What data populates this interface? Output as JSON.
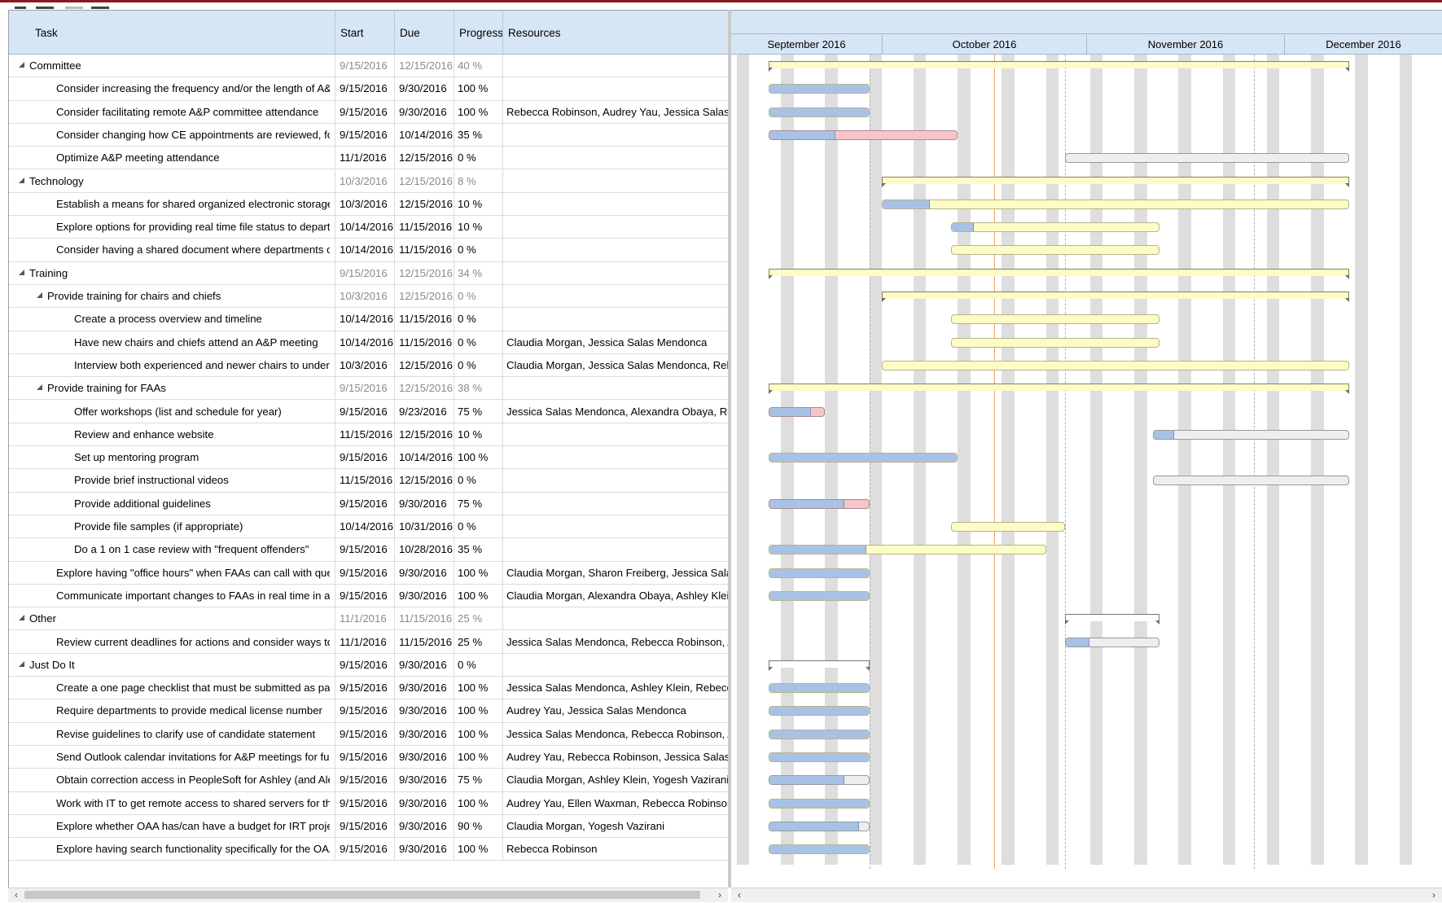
{
  "columns": {
    "task": "Task",
    "start": "Start",
    "due": "Due",
    "progress": "Progress",
    "resources": "Resources"
  },
  "months": [
    "September 2016",
    "October 2016",
    "November 2016",
    "December 2016"
  ],
  "scroll": {
    "left_arrow": "‹",
    "right_arrow": "›"
  },
  "colors": {
    "header_bg": "#d7e6f4",
    "progress_fill": "#a8c2e6",
    "bar_yellow": "#fdfbc6",
    "bar_red": "#f7c5c9",
    "bar_gray": "#eeeeee",
    "today_line": "#f0a060"
  },
  "rows": [
    {
      "task": "Committee",
      "start": "9/15/2016",
      "due": "12/15/2016",
      "progress": "40 %",
      "resources": "",
      "level": 0,
      "summary": true,
      "fill": 0.4,
      "color": "yellow"
    },
    {
      "task": "Consider increasing the frequency and/or the length of A&P meetings ...",
      "start": "9/15/2016",
      "due": "9/30/2016",
      "progress": "100 %",
      "resources": "",
      "level": 1,
      "fill": 1,
      "color": "yellow"
    },
    {
      "task": "Consider facilitating remote A&P committee attendance",
      "start": "9/15/2016",
      "due": "9/30/2016",
      "progress": "100 %",
      "resources": "Rebecca Robinson, Audrey Yau, Jessica Salas Mendonca",
      "level": 1,
      "fill": 1,
      "color": "yellow"
    },
    {
      "task": "Consider changing how CE appointments are reviewed, for instance if...",
      "start": "9/15/2016",
      "due": "10/14/2016",
      "progress": "35 %",
      "resources": "",
      "level": 1,
      "fill": 0.35,
      "color": "red"
    },
    {
      "task": "Optimize A&P meeting attendance",
      "start": "11/1/2016",
      "due": "12/15/2016",
      "progress": "0 %",
      "resources": "",
      "level": 1,
      "fill": 0,
      "color": "gray"
    },
    {
      "task": "Technology",
      "start": "10/3/2016",
      "due": "12/15/2016",
      "progress": "8 %",
      "resources": "",
      "level": 0,
      "summary": true,
      "fill": 0.08,
      "color": "yellow"
    },
    {
      "task": "Establish a means for shared organized electronic storage",
      "start": "10/3/2016",
      "due": "12/15/2016",
      "progress": "10 %",
      "resources": "",
      "level": 1,
      "fill": 0.1,
      "color": "yellow"
    },
    {
      "task": "Explore options for providing real time file status to departments",
      "start": "10/14/2016",
      "due": "11/15/2016",
      "progress": "10 %",
      "resources": "",
      "level": 1,
      "fill": 0.1,
      "color": "yellow"
    },
    {
      "task": "Consider having a shared document where departments could enter u...",
      "start": "10/14/2016",
      "due": "11/15/2016",
      "progress": "0 %",
      "resources": "",
      "level": 1,
      "fill": 0,
      "color": "yellow"
    },
    {
      "task": "Training",
      "start": "9/15/2016",
      "due": "12/15/2016",
      "progress": "34 %",
      "resources": "",
      "level": 0,
      "summary": true,
      "fill": 0.34,
      "color": "yellow"
    },
    {
      "task": "Provide training for chairs and chiefs",
      "start": "10/3/2016",
      "due": "12/15/2016",
      "progress": "0 %",
      "resources": "",
      "level": 1,
      "summary": true,
      "fill": 0,
      "color": "yellow"
    },
    {
      "task": "Create a process overview and timeline",
      "start": "10/14/2016",
      "due": "11/15/2016",
      "progress": "0 %",
      "resources": "",
      "level": 2,
      "fill": 0,
      "color": "yellow"
    },
    {
      "task": "Have new chairs and chiefs attend an A&P meeting",
      "start": "10/14/2016",
      "due": "11/15/2016",
      "progress": "0 %",
      "resources": "Claudia Morgan, Jessica Salas Mendonca",
      "level": 2,
      "fill": 0,
      "color": "yellow"
    },
    {
      "task": "Interview both experienced and newer chairs to understand how ...",
      "start": "10/3/2016",
      "due": "12/15/2016",
      "progress": "0 %",
      "resources": "Claudia Morgan, Jessica Salas Mendonca, Rebecca Robinson",
      "level": 2,
      "fill": 0,
      "color": "yellow"
    },
    {
      "task": "Provide training for FAAs",
      "start": "9/15/2016",
      "due": "12/15/2016",
      "progress": "38 %",
      "resources": "",
      "level": 1,
      "summary": true,
      "fill": 0.38,
      "color": "yellow"
    },
    {
      "task": "Offer workshops (list and schedule for year)",
      "start": "9/15/2016",
      "due": "9/23/2016",
      "progress": "75 %",
      "resources": "Jessica Salas Mendonca, Alexandra Obaya, Rebecca Robinson",
      "level": 2,
      "fill": 0.75,
      "color": "red"
    },
    {
      "task": "Review and enhance website",
      "start": "11/15/2016",
      "due": "12/15/2016",
      "progress": "10 %",
      "resources": "",
      "level": 2,
      "fill": 0.1,
      "color": "gray"
    },
    {
      "task": "Set up mentoring program",
      "start": "9/15/2016",
      "due": "10/14/2016",
      "progress": "100 %",
      "resources": "",
      "level": 2,
      "fill": 1,
      "color": "yellow"
    },
    {
      "task": "Provide brief instructional videos",
      "start": "11/15/2016",
      "due": "12/15/2016",
      "progress": "0 %",
      "resources": "",
      "level": 2,
      "fill": 0,
      "color": "gray"
    },
    {
      "task": "Provide additional guidelines",
      "start": "9/15/2016",
      "due": "9/30/2016",
      "progress": "75 %",
      "resources": "",
      "level": 2,
      "fill": 0.75,
      "color": "red"
    },
    {
      "task": "Provide file samples (if appropriate)",
      "start": "10/14/2016",
      "due": "10/31/2016",
      "progress": "0 %",
      "resources": "",
      "level": 2,
      "fill": 0,
      "color": "yellow"
    },
    {
      "task": "Do a 1 on 1 case review with \"frequent offenders\"",
      "start": "9/15/2016",
      "due": "10/28/2016",
      "progress": "35 %",
      "resources": "",
      "level": 2,
      "fill": 0.35,
      "color": "yellow"
    },
    {
      "task": "Explore having \"office hours\" when FAAs can call with questions",
      "start": "9/15/2016",
      "due": "9/30/2016",
      "progress": "100 %",
      "resources": "Claudia Morgan, Sharon Freiberg, Jessica Salas Mendonca",
      "level": 1,
      "fill": 1,
      "color": "yellow"
    },
    {
      "task": "Communicate important changes to FAAs in real time in addition to bat...",
      "start": "9/15/2016",
      "due": "9/30/2016",
      "progress": "100 %",
      "resources": "Claudia Morgan, Alexandra Obaya, Ashley Klein, Sharon Freiberg",
      "level": 1,
      "fill": 1,
      "color": "yellow"
    },
    {
      "task": "Other",
      "start": "11/1/2016",
      "due": "11/15/2016",
      "progress": "25 %",
      "resources": "",
      "level": 0,
      "summary": true,
      "fill": 0.25,
      "color": "white"
    },
    {
      "task": "Review current deadlines for actions and consider ways to enforce th...",
      "start": "11/1/2016",
      "due": "11/15/2016",
      "progress": "25 %",
      "resources": "Jessica Salas Mendonca, Rebecca Robinson, Audrey Yau",
      "level": 1,
      "fill": 0.25,
      "color": "gray"
    },
    {
      "task": "Just Do It",
      "start": "9/15/2016",
      "due": "9/30/2016",
      "progress": "0 %",
      "resources": "",
      "level": 0,
      "summary": true,
      "bold": true,
      "fill": 0,
      "color": "white"
    },
    {
      "task": "Create a one page checklist that must be submitted as page one of e...",
      "start": "9/15/2016",
      "due": "9/30/2016",
      "progress": "100 %",
      "resources": "Jessica Salas Mendonca, Ashley Klein, Rebecca Robinson",
      "level": 1,
      "fill": 1,
      "color": "yellow"
    },
    {
      "task": "Require departments to provide medical license number",
      "start": "9/15/2016",
      "due": "9/30/2016",
      "progress": "100 %",
      "resources": "Audrey Yau, Jessica Salas Mendonca",
      "level": 1,
      "fill": 1,
      "color": "yellow"
    },
    {
      "task": "Revise guidelines to clarify use of candidate statement",
      "start": "9/15/2016",
      "due": "9/30/2016",
      "progress": "100 %",
      "resources": "Jessica Salas Mendonca, Rebecca Robinson, Audrey Yau",
      "level": 1,
      "fill": 1,
      "color": "yellow"
    },
    {
      "task": "Send Outlook calendar invitations for A&P meetings for full year",
      "start": "9/15/2016",
      "due": "9/30/2016",
      "progress": "100 %",
      "resources": "Audrey Yau, Rebecca Robinson, Jessica Salas Mendonca",
      "level": 1,
      "fill": 1,
      "color": "yellow"
    },
    {
      "task": "Obtain correction access in PeopleSoft for Ashley (and Alexandra?)",
      "start": "9/15/2016",
      "due": "9/30/2016",
      "progress": "75 %",
      "resources": "Claudia Morgan, Ashley Klein, Yogesh Vazirani",
      "level": 1,
      "fill": 0.75,
      "color": "gray"
    },
    {
      "task": "Work with IT to get remote access to shared servers for those who do...",
      "start": "9/15/2016",
      "due": "9/30/2016",
      "progress": "100 %",
      "resources": "Audrey Yau, Ellen Waxman, Rebecca Robinson, Sharon Freiberg",
      "level": 1,
      "fill": 1,
      "color": "yellow"
    },
    {
      "task": "Explore whether OAA has/can have a budget for IRT project support",
      "start": "9/15/2016",
      "due": "9/30/2016",
      "progress": "90 %",
      "resources": "Claudia Morgan, Yogesh Vazirani",
      "level": 1,
      "fill": 0.9,
      "color": "gray"
    },
    {
      "task": "Explore having search functionality specifically for the OAA website",
      "start": "9/15/2016",
      "due": "9/30/2016",
      "progress": "100 %",
      "resources": "Rebecca Robinson",
      "level": 1,
      "fill": 1,
      "color": "yellow"
    }
  ]
}
